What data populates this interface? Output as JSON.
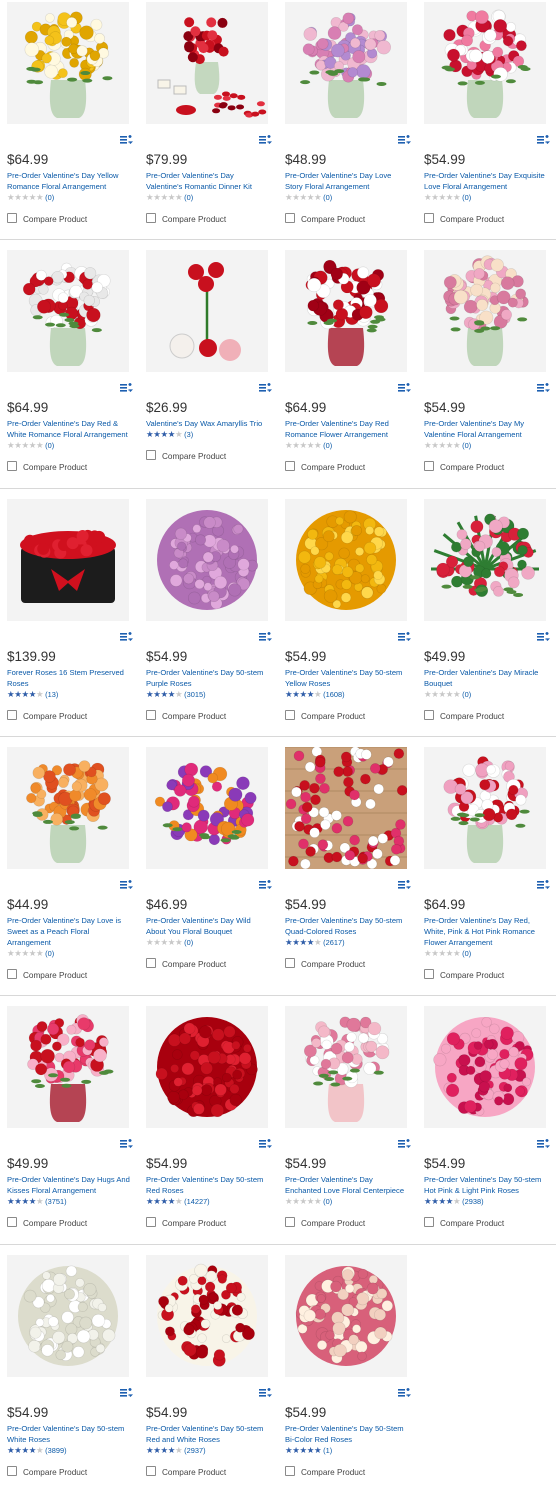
{
  "compare_label": "Compare Product",
  "products": [
    {
      "price": "$64.99",
      "title": "Pre-Order Valentine's Day Yellow Romance Floral Arrangement",
      "rating": 0,
      "reviews": "(0)",
      "image": "yellow-roses-vase",
      "colors": [
        "#f4c21a",
        "#fff9e0",
        "#e0a500"
      ]
    },
    {
      "price": "$79.99",
      "title": "Pre-Order Valentine's Day Valentine's Romantic Dinner Kit",
      "rating": 0,
      "reviews": "(0)",
      "image": "dinner-kit",
      "colors": [
        "#c8101e",
        "#e23040",
        "#8a0010"
      ]
    },
    {
      "price": "$48.99",
      "title": "Pre-Order Valentine's Day Love Story Floral Arrangement",
      "rating": 0,
      "reviews": "(0)",
      "image": "pink-lavender-mix",
      "colors": [
        "#d87fb3",
        "#b38ad1",
        "#f0b8d0"
      ]
    },
    {
      "price": "$54.99",
      "title": "Pre-Order Valentine's Day Exquisite Love Floral Arrangement",
      "rating": 0,
      "reviews": "(0)",
      "image": "red-lily-mix",
      "colors": [
        "#c8102e",
        "#f07aa0",
        "#ffffff"
      ]
    },
    {
      "price": "$64.99",
      "title": "Pre-Order Valentine's Day Red & White Romance Floral Arrangement",
      "rating": 0,
      "reviews": "(0)",
      "image": "red-white-roses",
      "colors": [
        "#c8101e",
        "#ffffff",
        "#e8e8e8"
      ]
    },
    {
      "price": "$26.99",
      "title": "Valentine's Day Wax Amaryllis Trio",
      "rating": 4,
      "reviews": "(3)",
      "image": "amaryllis-trio",
      "colors": [
        "#c8101e",
        "#f0b0b8",
        "#2f7a2a"
      ]
    },
    {
      "price": "$64.99",
      "title": "Pre-Order Valentine's Day Red Romance Flower Arrangement",
      "rating": 0,
      "reviews": "(0)",
      "image": "red-roses-red-vase",
      "colors": [
        "#c8101e",
        "#a00015",
        "#ffffff"
      ]
    },
    {
      "price": "$54.99",
      "title": "Pre-Order Valentine's Day My Valentine Floral Arrangement",
      "rating": 0,
      "reviews": "(0)",
      "image": "pink-hydrangea-mix",
      "colors": [
        "#f0a8c4",
        "#d87a9e",
        "#f8e0c8"
      ]
    },
    {
      "price": "$139.99",
      "title": "Forever Roses 16 Stem Preserved Roses",
      "rating": 4,
      "reviews": "(13)",
      "image": "red-roses-black-box",
      "colors": [
        "#d0101e",
        "#1c1c1c",
        "#e02030"
      ]
    },
    {
      "price": "$54.99",
      "title": "Pre-Order Valentine's Day 50-stem Purple Roses",
      "rating": 4,
      "reviews": "(3015)",
      "image": "purple-roses-dome",
      "colors": [
        "#c98bc8",
        "#b070b5",
        "#e0a8dc"
      ]
    },
    {
      "price": "$54.99",
      "title": "Pre-Order Valentine's Day 50-stem Yellow Roses",
      "rating": 4,
      "reviews": "(1608)",
      "image": "yellow-roses-dome",
      "colors": [
        "#f3b80f",
        "#e59a00",
        "#ffd84a"
      ]
    },
    {
      "price": "$49.99",
      "title": "Pre-Order Valentine's Day Miracle Bouquet",
      "rating": 0,
      "reviews": "(0)",
      "image": "tropical-bouquet",
      "colors": [
        "#d8203a",
        "#2e7d32",
        "#f0a8c4"
      ]
    },
    {
      "price": "$44.99",
      "title": "Pre-Order Valentine's Day Love is Sweet as a Peach Floral Arrangement",
      "rating": 0,
      "reviews": "(0)",
      "image": "peach-orange-mix",
      "colors": [
        "#f08a2a",
        "#f8b060",
        "#e05020"
      ]
    },
    {
      "price": "$46.99",
      "title": "Pre-Order Valentine's Day Wild About You Floral Bouquet",
      "rating": 0,
      "reviews": "(0)",
      "image": "wild-bouquet",
      "colors": [
        "#e02a7a",
        "#f08a20",
        "#8a3ab8"
      ]
    },
    {
      "price": "$54.99",
      "title": "Pre-Order Valentine's Day 50-stem Quad-Colored Roses",
      "rating": 4,
      "reviews": "(2617)",
      "image": "quad-roses-wood",
      "colors": [
        "#c8101e",
        "#ffffff",
        "#e0306a"
      ]
    },
    {
      "price": "$64.99",
      "title": "Pre-Order Valentine's Day Red, White, Pink & Hot Pink Romance Flower Arrangement",
      "rating": 0,
      "reviews": "(0)",
      "image": "multi-rose-vase",
      "colors": [
        "#c8101e",
        "#f0a0c0",
        "#ffffff"
      ]
    },
    {
      "price": "$49.99",
      "title": "Pre-Order Valentine's Day Hugs And Kisses Floral Arrangement",
      "rating": 4,
      "reviews": "(3751)",
      "image": "pink-lily-red-vase",
      "colors": [
        "#e83a6a",
        "#c8101e",
        "#f8b0c8"
      ]
    },
    {
      "price": "$54.99",
      "title": "Pre-Order Valentine's Day 50-stem Red Roses",
      "rating": 4,
      "reviews": "(14227)",
      "image": "red-roses-dome",
      "colors": [
        "#c8101e",
        "#a8000e",
        "#e02030"
      ]
    },
    {
      "price": "$54.99",
      "title": "Pre-Order Valentine's Day Enchanted Love Floral Centerpiece",
      "rating": 0,
      "reviews": "(0)",
      "image": "pink-centerpiece",
      "colors": [
        "#f4b8c8",
        "#ffffff",
        "#e0789a"
      ]
    },
    {
      "price": "$54.99",
      "title": "Pre-Order Valentine's Day 50-stem Hot Pink & Light Pink Roses",
      "rating": 4,
      "reviews": "(2938)",
      "image": "pink-roses-dome",
      "colors": [
        "#e0205e",
        "#f7a6c4",
        "#c8104e"
      ]
    },
    {
      "price": "$54.99",
      "title": "Pre-Order Valentine's Day 50-stem White Roses",
      "rating": 4,
      "reviews": "(3899)",
      "image": "white-roses-dome",
      "colors": [
        "#f2f2ea",
        "#dcdccc",
        "#ffffff"
      ]
    },
    {
      "price": "$54.99",
      "title": "Pre-Order Valentine's Day 50-stem Red and White Roses",
      "rating": 4,
      "reviews": "(2937)",
      "image": "red-white-dome",
      "colors": [
        "#c8101e",
        "#f8f4e8",
        "#a8000e"
      ]
    },
    {
      "price": "$54.99",
      "title": "Pre-Order Valentine's Day 50-Stem Bi-Color Red Roses",
      "rating": 5,
      "reviews": "(1)",
      "image": "bicolor-roses-dome",
      "colors": [
        "#f2d0c0",
        "#d8607a",
        "#fff0e0"
      ]
    }
  ]
}
